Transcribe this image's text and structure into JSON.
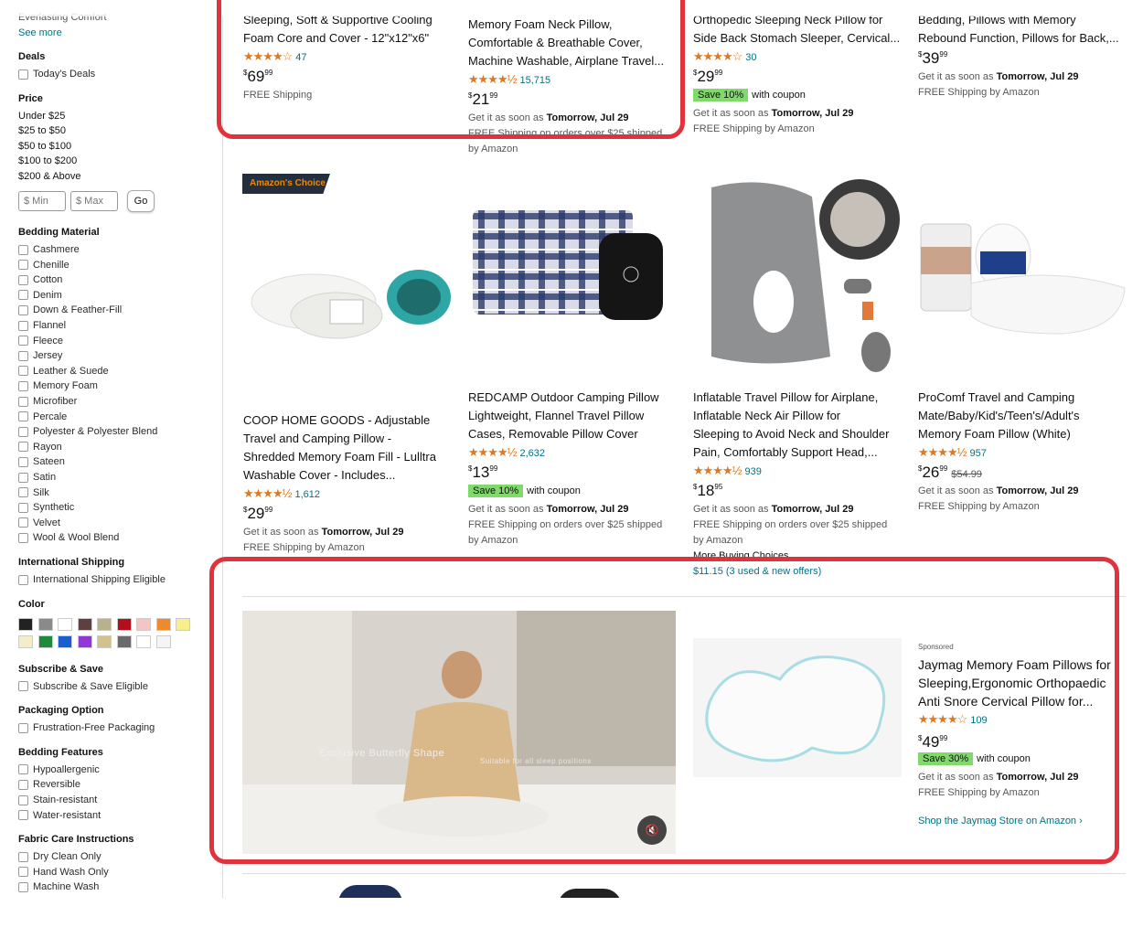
{
  "sidebar": {
    "top_item": "Everlasting Comfort",
    "see_more": "See more",
    "deals": {
      "title": "Deals",
      "items": [
        "Today's Deals"
      ]
    },
    "price": {
      "title": "Price",
      "ranges": [
        "Under $25",
        "$25 to $50",
        "$50 to $100",
        "$100 to $200",
        "$200 & Above"
      ],
      "min_placeholder": "$ Min",
      "max_placeholder": "$ Max",
      "go": "Go"
    },
    "bedding_material": {
      "title": "Bedding Material",
      "items": [
        "Cashmere",
        "Chenille",
        "Cotton",
        "Denim",
        "Down & Feather-Fill",
        "Flannel",
        "Fleece",
        "Jersey",
        "Leather & Suede",
        "Memory Foam",
        "Microfiber",
        "Percale",
        "Polyester & Polyester Blend",
        "Rayon",
        "Sateen",
        "Satin",
        "Silk",
        "Synthetic",
        "Velvet",
        "Wool & Wool Blend"
      ]
    },
    "international_shipping": {
      "title": "International Shipping",
      "items": [
        "International Shipping Eligible"
      ]
    },
    "color": {
      "title": "Color",
      "swatches": [
        "#222222",
        "#8a8a8a",
        "#ffffff",
        "#5e4040",
        "#b9b08c",
        "#b30f1a",
        "#f5c4c4",
        "#ef8a2a",
        "#f7ef8a",
        "#f1eec9",
        "#1f8a3a",
        "#1a5fd0",
        "#9236d8",
        "#d4c28c",
        "#6a6a6a",
        "#ffffff",
        "#f5f5f5"
      ]
    },
    "subscribe": {
      "title": "Subscribe & Save",
      "items": [
        "Subscribe & Save Eligible"
      ]
    },
    "packaging": {
      "title": "Packaging Option",
      "items": [
        "Frustration-Free Packaging"
      ]
    },
    "bedding_features": {
      "title": "Bedding Features",
      "items": [
        "Hypoallergenic",
        "Reversible",
        "Stain-resistant",
        "Water-resistant"
      ]
    },
    "fabric_care": {
      "title": "Fabric Care Instructions",
      "items": [
        "Dry Clean Only",
        "Hand Wash Only",
        "Machine Wash"
      ]
    }
  },
  "row1": [
    {
      "title_lines": [
        "Sleeping, Soft & Supportive Cooling",
        "Foam Core and Cover - 12\"x12\"x6\""
      ],
      "stars": "★★★★☆",
      "reviews": "47",
      "price_whole": "69",
      "price_frac": "99",
      "ship1": "FREE Shipping"
    },
    {
      "title_lines": [
        "Memory Foam Neck Pillow,",
        "Comfortable & Breathable Cover,",
        "Machine Washable, Airplane Travel..."
      ],
      "stars": "★★★★½",
      "reviews": "15,715",
      "price_whole": "21",
      "price_frac": "99",
      "ship1_pre": "Get it as soon as ",
      "ship1_bold": "Tomorrow, Jul 29",
      "ship2": "FREE Shipping on orders over $25 shipped",
      "ship3": "by Amazon"
    },
    {
      "title_lines": [
        "Orthopedic Sleeping Neck Pillow for",
        "Side Back Stomach Sleeper, Cervical..."
      ],
      "stars": "★★★★☆",
      "reviews": "30",
      "price_whole": "29",
      "price_frac": "99",
      "coupon_badge": "Save 10%",
      "coupon_text": "with coupon",
      "ship1_pre": "Get it as soon as ",
      "ship1_bold": "Tomorrow, Jul 29",
      "ship2": "FREE Shipping by Amazon"
    },
    {
      "title_lines": [
        "Bedding, Pillows with Memory",
        "Rebound Function, Pillows for Back,..."
      ],
      "price_whole": "39",
      "price_frac": "99",
      "ship1_pre": "Get it as soon as ",
      "ship1_bold": "Tomorrow, Jul 29",
      "ship2": "FREE Shipping by Amazon"
    }
  ],
  "row2": [
    {
      "badge": "Amazon's",
      "badge_accent": "Choice",
      "title_lines": [
        "COOP HOME GOODS - Adjustable",
        "Travel and Camping Pillow -",
        "Shredded Memory Foam Fill - Lulltra",
        "Washable Cover - Includes..."
      ],
      "stars": "★★★★½",
      "reviews": "1,612",
      "price_whole": "29",
      "price_frac": "99",
      "ship1_pre": "Get it as soon as ",
      "ship1_bold": "Tomorrow, Jul 29",
      "ship2": "FREE Shipping by Amazon"
    },
    {
      "title_lines": [
        "REDCAMP Outdoor Camping Pillow",
        "Lightweight, Flannel Travel Pillow",
        "Cases, Removable Pillow Cover"
      ],
      "stars": "★★★★½",
      "reviews": "2,632",
      "price_whole": "13",
      "price_frac": "99",
      "coupon_badge": "Save 10%",
      "coupon_text": "with coupon",
      "ship1_pre": "Get it as soon as ",
      "ship1_bold": "Tomorrow, Jul 29",
      "ship2": "FREE Shipping on orders over $25 shipped",
      "ship3": "by Amazon"
    },
    {
      "title_lines": [
        "Inflatable Travel Pillow for Airplane,",
        "Inflatable Neck Air Pillow for",
        "Sleeping to Avoid Neck and Shoulder",
        "Pain, Comfortably Support Head,..."
      ],
      "stars": "★★★★½",
      "reviews": "939",
      "price_whole": "18",
      "price_frac": "95",
      "ship1_pre": "Get it as soon as ",
      "ship1_bold": "Tomorrow, Jul 29",
      "ship2": "FREE Shipping on orders over $25 shipped",
      "ship3": "by Amazon",
      "more_choices": "More Buying Choices",
      "other_offers": "$11.15 (3 used & new offers)"
    },
    {
      "title_lines": [
        "ProComf Travel and Camping",
        "Mate/Baby/Kid's/Teen's/Adult's",
        "Memory Foam Pillow (White)"
      ],
      "stars": "★★★★½",
      "reviews": "957",
      "price_whole": "26",
      "price_frac": "99",
      "list_price": "$54.99",
      "ship1_pre": "Get it as soon as ",
      "ship1_bold": "Tomorrow, Jul 29",
      "ship2": "FREE Shipping by Amazon"
    }
  ],
  "sponsored": {
    "video_caption": "Exclusive Butterfly Shape",
    "video_sub": "Suitable for all sleep positions",
    "mute": "🔇",
    "label": "Sponsored",
    "title_lines": [
      "Jaymag Memory Foam Pillows for",
      "Sleeping,Ergonomic Orthopaedic",
      "Anti Snore Cervical Pillow for..."
    ],
    "stars": "★★★★☆",
    "reviews": "109",
    "price_whole": "49",
    "price_frac": "99",
    "coupon_badge": "Save 30%",
    "coupon_text": "with coupon",
    "ship1_pre": "Get it as soon as ",
    "ship1_bold": "Tomorrow, Jul 29",
    "ship2": "FREE Shipping by Amazon",
    "store_link": "Shop the Jaymag Store on Amazon ›"
  }
}
